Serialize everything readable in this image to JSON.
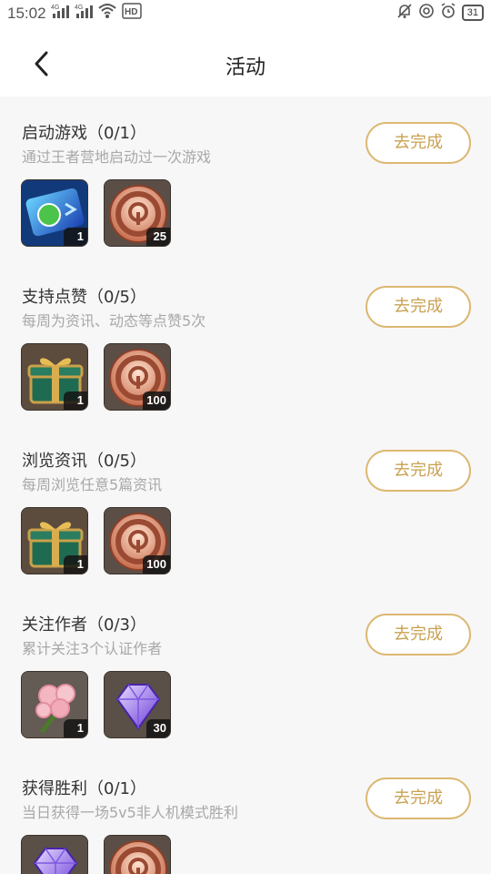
{
  "status": {
    "time": "15:02",
    "net1": "4G",
    "net2": "4G",
    "hd": "HD",
    "battery": "31"
  },
  "header": {
    "title": "活动",
    "back_icon": "chevron-left-icon"
  },
  "tasks": [
    {
      "title": "启动游戏（0/1）",
      "desc": "通过王者营地启动过一次游戏",
      "button": "去完成",
      "rewards": [
        {
          "icon": "exp-card-icon",
          "qty": "1"
        },
        {
          "icon": "camp-coin-icon",
          "qty": "25"
        }
      ]
    },
    {
      "title": "支持点赞（0/5）",
      "desc": "每周为资讯、动态等点赞5次",
      "button": "去完成",
      "rewards": [
        {
          "icon": "gift-box-icon",
          "qty": "1"
        },
        {
          "icon": "camp-coin-icon",
          "qty": "100"
        }
      ]
    },
    {
      "title": "浏览资讯（0/5）",
      "desc": "每周浏览任意5篇资讯",
      "button": "去完成",
      "rewards": [
        {
          "icon": "gift-box-icon",
          "qty": "1"
        },
        {
          "icon": "camp-coin-icon",
          "qty": "100"
        }
      ]
    },
    {
      "title": "关注作者（0/3）",
      "desc": "累计关注3个认证作者",
      "button": "去完成",
      "rewards": [
        {
          "icon": "rose-bouquet-icon",
          "qty": "1"
        },
        {
          "icon": "purple-diamond-icon",
          "qty": "30"
        }
      ]
    },
    {
      "title": "获得胜利（0/1）",
      "desc": "当日获得一场5v5非人机模式胜利",
      "button": "去完成",
      "rewards": [
        {
          "icon": "purple-diamond-icon",
          "qty": ""
        },
        {
          "icon": "camp-coin-icon",
          "qty": ""
        }
      ]
    }
  ],
  "colors": {
    "accent": "#c9a252",
    "button_border": "#dcb872",
    "bg": "#f7f7f7",
    "desc": "#a8a8a8"
  }
}
